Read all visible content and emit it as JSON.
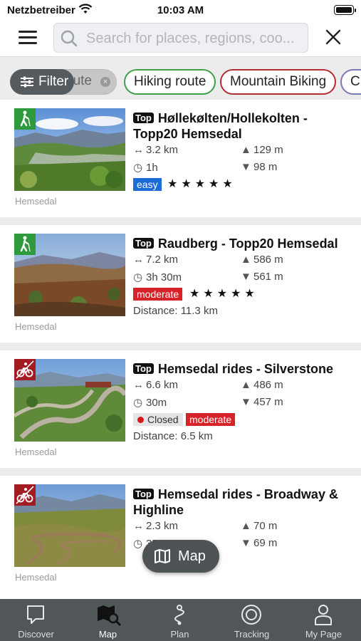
{
  "status_bar": {
    "carrier": "Netzbetreiber",
    "time": "10:03 AM"
  },
  "search": {
    "placeholder": "Search for places, regions, coo..."
  },
  "filters": {
    "filter_label": "Filter",
    "chips": [
      {
        "label": "ute"
      },
      {
        "label": "Hiking route"
      },
      {
        "label": "Mountain Biking"
      },
      {
        "label": "Cr"
      }
    ]
  },
  "colors": {
    "hiking": "#2f9a3b",
    "biking": "#a31c22",
    "easy": "#1c6bd6",
    "moderate": "#d8222a"
  },
  "routes": [
    {
      "top": "Top",
      "title": "Høllekølten/Hollekolten - Topp20 Hemsedal",
      "type_icon": "hiking-icon",
      "distance": "3.2 km",
      "duration": "1h",
      "ascent": "129 m",
      "descent": "98 m",
      "difficulty": "easy",
      "stars": "★★★★★",
      "region": "Hemsedal"
    },
    {
      "top": "Top",
      "title": "Raudberg - Topp20 Hemsedal",
      "type_icon": "hiking-icon",
      "distance": "7.2 km",
      "duration": "3h 30m",
      "ascent": "586 m",
      "descent": "561 m",
      "difficulty": "moderate",
      "stars": "★★★★★",
      "distance_from_me": "Distance: 11.3 km",
      "region": "Hemsedal"
    },
    {
      "top": "Top",
      "title": "Hemsedal rides - Silverstone",
      "type_icon": "mountain-bike-icon",
      "distance": "6.6 km",
      "duration": "30m",
      "ascent": "486 m",
      "descent": "457 m",
      "status": "Closed",
      "difficulty": "moderate",
      "distance_from_me": "Distance: 6.5 km",
      "region": "Hemsedal"
    },
    {
      "top": "Top",
      "title": "Hemsedal rides - Broadway & Highline",
      "type_icon": "mountain-bike-icon",
      "distance": "2.3 km",
      "duration": "35",
      "ascent": "70 m",
      "descent": "69 m",
      "region": "Hemsedal"
    }
  ],
  "map_button": {
    "label": "Map"
  },
  "tabs": [
    {
      "label": "Discover",
      "icon": "discover-icon"
    },
    {
      "label": "Map",
      "icon": "map-search-icon",
      "active": true
    },
    {
      "label": "Plan",
      "icon": "plan-route-icon"
    },
    {
      "label": "Tracking",
      "icon": "tracking-icon"
    },
    {
      "label": "My Page",
      "icon": "person-icon"
    }
  ]
}
